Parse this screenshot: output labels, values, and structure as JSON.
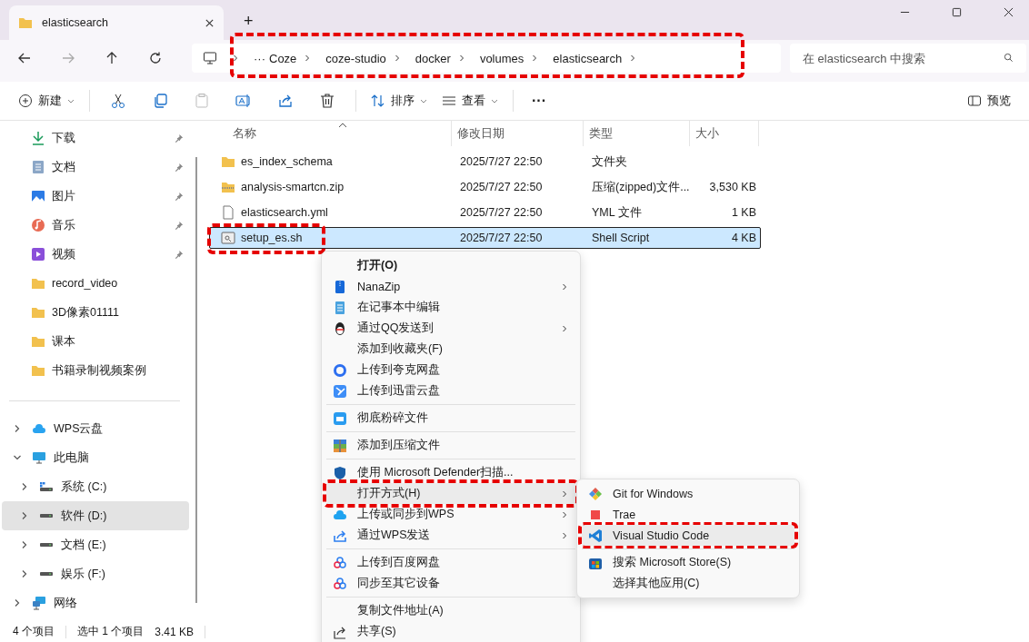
{
  "window": {
    "tab_title": "elasticsearch",
    "new_tab": "+"
  },
  "address": {
    "more": "···",
    "crumbs": [
      "Coze",
      "coze-studio",
      "docker",
      "volumes",
      "elasticsearch"
    ],
    "highlighted": true
  },
  "search": {
    "placeholder": "在 elasticsearch 中搜索"
  },
  "toolbar": {
    "new": "新建",
    "sort": "排序",
    "view": "查看",
    "more": "···",
    "preview": "预览"
  },
  "sidebar": {
    "quick_access": [
      {
        "label": "下载",
        "pinned": true
      },
      {
        "label": "文档",
        "pinned": true
      },
      {
        "label": "图片",
        "pinned": true
      },
      {
        "label": "音乐",
        "pinned": true
      },
      {
        "label": "视频",
        "pinned": true
      },
      {
        "label": "record_video",
        "pinned": false
      },
      {
        "label": "3D像素01111",
        "pinned": false
      },
      {
        "label": "课本",
        "pinned": false
      },
      {
        "label": "书籍录制视频案例",
        "pinned": false
      }
    ],
    "tree": [
      {
        "label": "WPS云盘",
        "expanded": false,
        "selected": false
      },
      {
        "label": "此电脑",
        "expanded": true,
        "selected": false,
        "children": [
          {
            "label": "系统 (C:)",
            "expanded": false,
            "selected": false
          },
          {
            "label": "软件 (D:)",
            "expanded": false,
            "selected": true
          },
          {
            "label": "文档 (E:)",
            "expanded": false,
            "selected": false
          },
          {
            "label": "娱乐 (F:)",
            "expanded": false,
            "selected": false
          }
        ]
      },
      {
        "label": "网络",
        "expanded": false,
        "selected": false
      }
    ]
  },
  "file_list": {
    "columns": [
      "名称",
      "修改日期",
      "类型",
      "大小"
    ],
    "rows": [
      {
        "kind": "folder",
        "name": "es_index_schema",
        "date": "2025/7/27 22:50",
        "type": "文件夹",
        "selected": false,
        "highlighted": false
      },
      {
        "kind": "archive",
        "name": "analysis-smartcn.zip",
        "date": "2025/7/27 22:50",
        "type": "压缩(zipped)文件...",
        "size": "3,530 KB",
        "selected": false,
        "highlighted": false
      },
      {
        "kind": "document",
        "name": "elasticsearch.yml",
        "date": "2025/7/27 22:50",
        "type": "YML 文件",
        "size": "1 KB",
        "selected": false,
        "highlighted": false
      },
      {
        "kind": "script",
        "name": "setup_es.sh",
        "date": "2025/7/27 22:50",
        "type": "Shell Script",
        "size": "4 KB",
        "selected": true,
        "highlighted": true
      }
    ]
  },
  "context_menu": {
    "items": [
      {
        "kind": "item",
        "label": "打开(O)",
        "bold": true,
        "submenu": false,
        "hovered": false,
        "highlighted": false
      },
      {
        "kind": "item",
        "label": "NanaZip",
        "bold": false,
        "submenu": true,
        "hovered": false,
        "highlighted": false
      },
      {
        "kind": "item",
        "label": "在记事本中编辑",
        "bold": false,
        "submenu": false,
        "hovered": false,
        "highlighted": false
      },
      {
        "kind": "item",
        "label": "通过QQ发送到",
        "bold": false,
        "submenu": true,
        "hovered": false,
        "highlighted": false
      },
      {
        "kind": "item",
        "label": "添加到收藏夹(F)",
        "bold": false,
        "submenu": false,
        "hovered": false,
        "highlighted": false
      },
      {
        "kind": "item",
        "label": "上传到夸克网盘",
        "bold": false,
        "submenu": false,
        "hovered": false,
        "highlighted": false
      },
      {
        "kind": "item",
        "label": "上传到迅雷云盘",
        "bold": false,
        "submenu": false,
        "hovered": false,
        "highlighted": false
      },
      {
        "kind": "separator"
      },
      {
        "kind": "item",
        "label": "彻底粉碎文件",
        "bold": false,
        "submenu": false,
        "hovered": false,
        "highlighted": false
      },
      {
        "kind": "separator"
      },
      {
        "kind": "item",
        "label": "添加到压缩文件",
        "bold": false,
        "submenu": false,
        "hovered": false,
        "highlighted": false
      },
      {
        "kind": "separator"
      },
      {
        "kind": "item",
        "label": "使用 Microsoft Defender扫描...",
        "bold": false,
        "submenu": false,
        "hovered": false,
        "highlighted": false
      },
      {
        "kind": "item",
        "label": "打开方式(H)",
        "bold": false,
        "submenu": true,
        "hovered": true,
        "highlighted": true
      },
      {
        "kind": "item",
        "label": "上传或同步到WPS",
        "bold": false,
        "submenu": true,
        "hovered": false,
        "highlighted": false
      },
      {
        "kind": "item",
        "label": "通过WPS发送",
        "bold": false,
        "submenu": true,
        "hovered": false,
        "highlighted": false
      },
      {
        "kind": "separator"
      },
      {
        "kind": "item",
        "label": "上传到百度网盘",
        "bold": false,
        "submenu": false,
        "hovered": false,
        "highlighted": false
      },
      {
        "kind": "item",
        "label": "同步至其它设备",
        "bold": false,
        "submenu": false,
        "hovered": false,
        "highlighted": false
      },
      {
        "kind": "separator"
      },
      {
        "kind": "item",
        "label": "复制文件地址(A)",
        "bold": false,
        "submenu": false,
        "hovered": false,
        "highlighted": false
      },
      {
        "kind": "item",
        "label": "共享(S)",
        "bold": false,
        "submenu": false,
        "hovered": false,
        "highlighted": false
      }
    ]
  },
  "open_with_menu": {
    "items": [
      {
        "kind": "item",
        "label": "Git for Windows",
        "hovered": false,
        "highlighted": false
      },
      {
        "kind": "item",
        "label": "Trae",
        "hovered": false,
        "highlighted": false
      },
      {
        "kind": "item",
        "label": "Visual Studio Code",
        "hovered": true,
        "highlighted": true
      },
      {
        "kind": "separator"
      },
      {
        "kind": "item",
        "label": "搜索 Microsoft Store(S)",
        "hovered": false,
        "highlighted": false
      },
      {
        "kind": "item",
        "label": "选择其他应用(C)",
        "hovered": false,
        "highlighted": false
      }
    ]
  },
  "status_bar": {
    "count": "4 个项目",
    "selection": "选中 1 个项目",
    "size": "3.41 KB"
  }
}
